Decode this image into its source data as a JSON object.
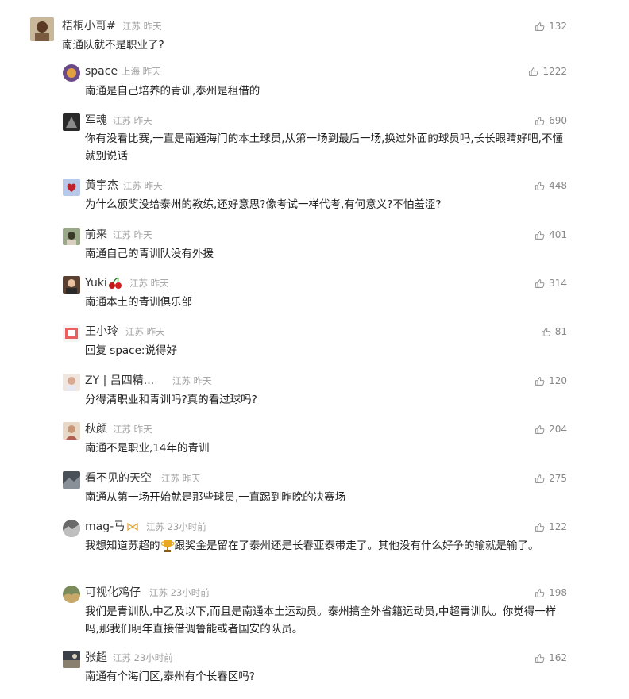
{
  "comments": [
    {
      "user": "梧桐小哥#",
      "location": "江苏",
      "time": "昨天",
      "likes": "132",
      "text": "南通队就不是职业了?",
      "avatar": "avatar-1"
    },
    {
      "user": "space",
      "location": "上海",
      "time": "昨天",
      "likes": "1222",
      "text": "南通是自己培养的青训,泰州是租借的"
    },
    {
      "user": "军魂",
      "location": "江苏",
      "time": "昨天",
      "likes": "690",
      "text": "你有没看比赛,一直是南通海门的本土球员,从第一场到最后一场,换过外面的球员吗,长长眼睛好吧,不懂就别说话"
    },
    {
      "user": "黄宇杰",
      "location": "江苏",
      "time": "昨天",
      "likes": "448",
      "text": "为什么颁奖没给泰州的教练,还好意思?像考试一样代考,有何意义?不怕羞涩?"
    },
    {
      "user": "前来",
      "location": "江苏",
      "time": "昨天",
      "likes": "401",
      "text": "南通自己的青训队没有外援"
    },
    {
      "user": "Yuki",
      "location": "江苏",
      "time": "昨天",
      "likes": "314",
      "text": "南通本土的青训俱乐部"
    },
    {
      "user": "王小玲",
      "location": "江苏",
      "time": "昨天",
      "likes": "81",
      "reply_prefix": "回复",
      "reply_to": "space",
      "reply_text": "说得好"
    },
    {
      "user": "ZY | 吕四精...",
      "location": "江苏",
      "time": "昨天",
      "likes": "120",
      "text": "分得清职业和青训吗?真的看过球吗?"
    },
    {
      "user": "秋颜",
      "location": "江苏",
      "time": "昨天",
      "likes": "204",
      "text": "南通不是职业,14年的青训"
    },
    {
      "user": "看不见的天空",
      "location": "江苏",
      "time": "昨天",
      "likes": "275",
      "text": "南通从第一场开始就是那些球员,一直踢到昨晚的决赛场"
    },
    {
      "user": "mag-马",
      "location": "江苏",
      "time": "23小时前",
      "likes": "122",
      "text_a": "我想知道苏超的",
      "text_b": "跟奖金是留在了泰州还是长春亚泰带走了。其他没有什么好争的输就是输了。"
    },
    {
      "user": "可视化鸡仔",
      "location": "江苏",
      "time": "23小时前",
      "likes": "198",
      "text": "我们是青训队,中乙及以下,而且是南通本土运动员。泰州搞全外省籍运动员,中超青训队。你觉得一样吗,那我们明年直接借调鲁能或者国安的队员。"
    },
    {
      "user": "张超",
      "location": "江苏",
      "time": "23小时前",
      "likes": "162",
      "text": "南通有个海门区,泰州有个长春区吗?"
    }
  ]
}
